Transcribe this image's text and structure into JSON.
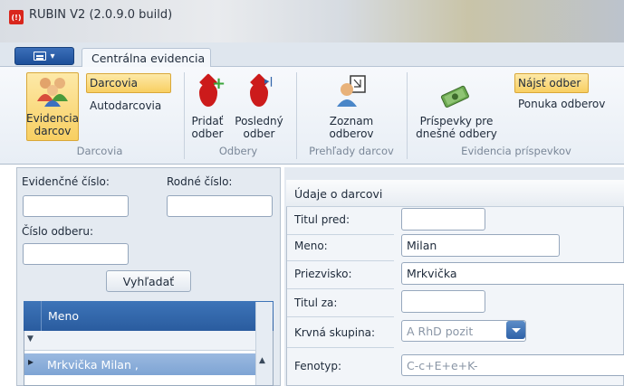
{
  "window": {
    "title": "RUBIN V2 (2.0.9.0 build)",
    "app_icon_glyph": "(!)"
  },
  "ribbon": {
    "app_menu_arrow": "▾",
    "active_tab": "Centrálna evidencia",
    "groups": {
      "darcovia": {
        "label": "Darcovia",
        "big_button": [
          "Evidencia",
          "darcov"
        ],
        "small_buttons": [
          "Darcovia",
          "Autodarcovia"
        ]
      },
      "odbery": {
        "label": "Odbery",
        "add": [
          "Pridať",
          "odber"
        ],
        "last": [
          "Posledný",
          "odber"
        ]
      },
      "prehlady": {
        "label": "Prehľady darcov",
        "list": [
          "Zoznam",
          "odberov"
        ]
      },
      "prispevky": {
        "label": "Evidencia príspevkov",
        "contributions": [
          "Príspevky pre",
          "dnešné odbery"
        ],
        "find": "Nájsť odber",
        "offer": "Ponuka odberov"
      }
    }
  },
  "search_panel": {
    "evidence_label": "Evidenčné číslo:",
    "birth_label": "Rodné číslo:",
    "collection_label": "Číslo odberu:",
    "search_button": "Vyhľadať",
    "grid": {
      "column": "Meno",
      "filter_icon": "▼",
      "row_marker": "▸",
      "rows": [
        "Mrkvička Milan ,"
      ]
    }
  },
  "detail_panel": {
    "section_title": "Údaje o darcovi",
    "fields": [
      {
        "label": "Titul pred:",
        "value": ""
      },
      {
        "label": "Meno:",
        "value": "Milan"
      },
      {
        "label": "Priezvisko:",
        "value": "Mrkvička"
      },
      {
        "label": "Titul za:",
        "value": ""
      },
      {
        "label": "Krvná skupina:",
        "value": "A RhD pozit"
      },
      {
        "label": "Fenotyp:",
        "value": "C-c+E+e+K-"
      }
    ]
  },
  "colors": {
    "accent_blue": "#2a5c9f",
    "selected_yellow": "#f8cf62",
    "drop_red": "#cc1b1b"
  }
}
